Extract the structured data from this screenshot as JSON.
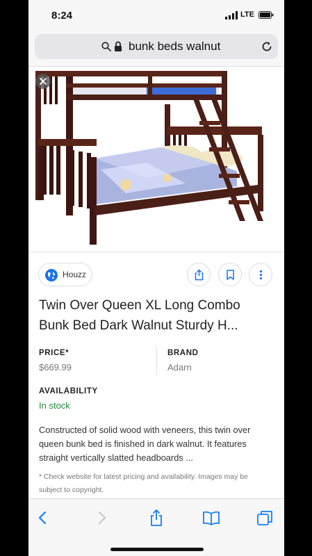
{
  "status_bar": {
    "time": "8:24",
    "network": "LTE"
  },
  "url_bar": {
    "text": "bunk beds walnut"
  },
  "source": {
    "name": "Houzz"
  },
  "product": {
    "title": "Twin Over Queen XL Long Combo Bunk Bed Dark Walnut Sturdy H...",
    "price_label": "PRICE*",
    "price_value": "$669.99",
    "brand_label": "BRAND",
    "brand_value": "Adarn",
    "availability_label": "AVAILABILITY",
    "availability_value": "In stock",
    "description": "Constructed of solid wood with veneers, this twin over queen bunk bed is finished in dark walnut. It features straight vertically slatted headboards ...",
    "disclaimer": "* Check website for latest pricing and availability. Images may be subject to copyright."
  },
  "colors": {
    "accent": "#1a73e8",
    "in_stock": "#1e8e3e",
    "wood": "#4a1f17",
    "safari_blue": "#147efb"
  }
}
